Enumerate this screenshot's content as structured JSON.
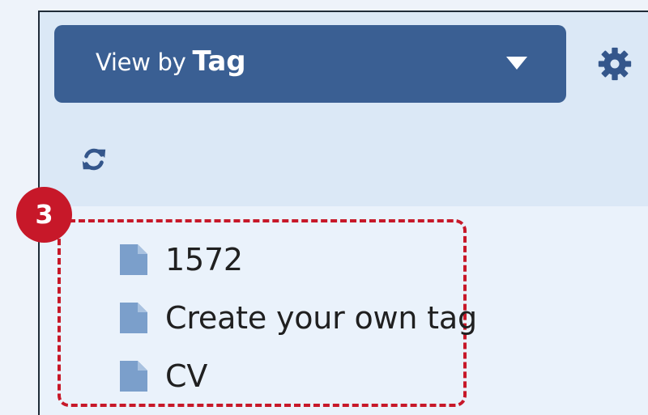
{
  "header": {
    "view_prefix": "View by",
    "view_value": "Tag"
  },
  "tags": [
    {
      "label": "1572"
    },
    {
      "label": "Create your own tag"
    },
    {
      "label": "CV"
    }
  ],
  "annotation": {
    "badge": "3"
  },
  "colors": {
    "primary": "#3a5f93",
    "background": "#eaf2fb",
    "toolbar": "#dbe8f6",
    "annotation": "#c71829"
  },
  "icons": {
    "dropdown": "chevron-down-icon",
    "settings": "gear-icon",
    "refresh": "refresh-icon",
    "tag": "file-icon"
  }
}
